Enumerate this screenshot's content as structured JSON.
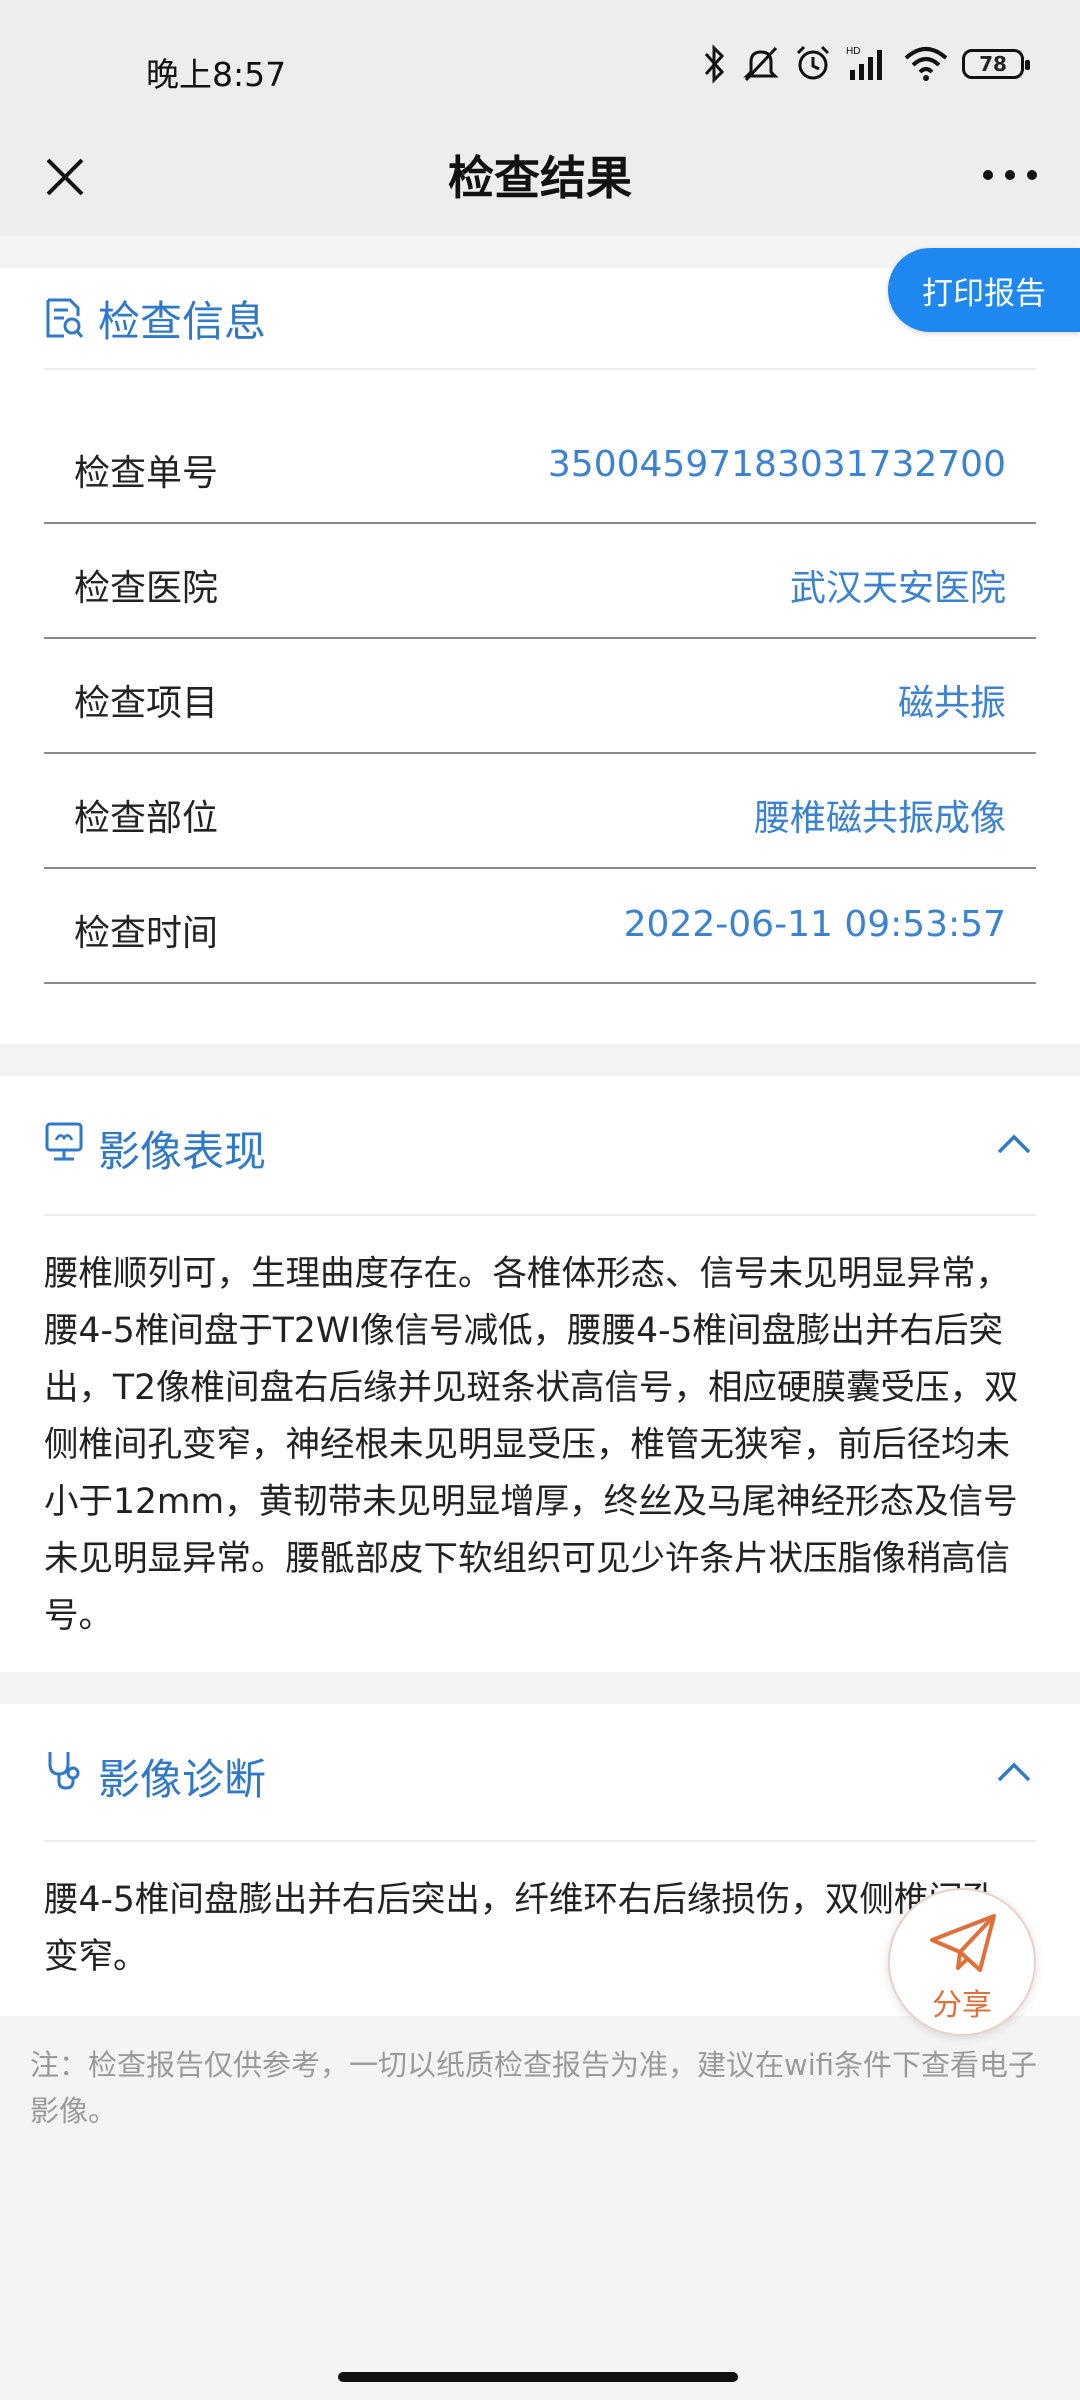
{
  "status_bar": {
    "time": "晚上8:57",
    "battery": "78"
  },
  "nav": {
    "title": "检查结果"
  },
  "print_button": "打印报告",
  "exam_info": {
    "title": "检查信息",
    "rows": [
      {
        "label": "检查单号",
        "value": "35004597183031732700"
      },
      {
        "label": "检查医院",
        "value": "武汉天安医院"
      },
      {
        "label": "检查项目",
        "value": "磁共振"
      },
      {
        "label": "检查部位",
        "value": "腰椎磁共振成像"
      },
      {
        "label": "检查时间",
        "value": "2022-06-11 09:53:57"
      }
    ]
  },
  "imaging_findings": {
    "title": "影像表现",
    "text": "腰椎顺列可，生理曲度存在。各椎体形态、信号未见明显异常，腰4-5椎间盘于T2WI像信号减低，腰腰4-5椎间盘膨出并右后突出，T2像椎间盘右后缘并见斑条状高信号，相应硬膜囊受压，双侧椎间孔变窄，神经根未见明显受压，椎管无狭窄，前后径均未小于12mm，黄韧带未见明显增厚，终丝及马尾神经形态及信号未见明显异常。腰骶部皮下软组织可见少许条片状压脂像稍高信号。"
  },
  "imaging_diagnosis": {
    "title": "影像诊断",
    "text": "腰4-5椎间盘膨出并右后突出，纤维环右后缘损伤，双侧椎间孔变窄。"
  },
  "share_button": "分享",
  "note": "注：检查报告仅供参考，一切以纸质检查报告为准，建议在wifi条件下查看电子影像。",
  "colors": {
    "accent": "#3b82d2",
    "title_blue": "#2f79c8",
    "print_button": "#1e88f0",
    "share": "#e0703a"
  }
}
